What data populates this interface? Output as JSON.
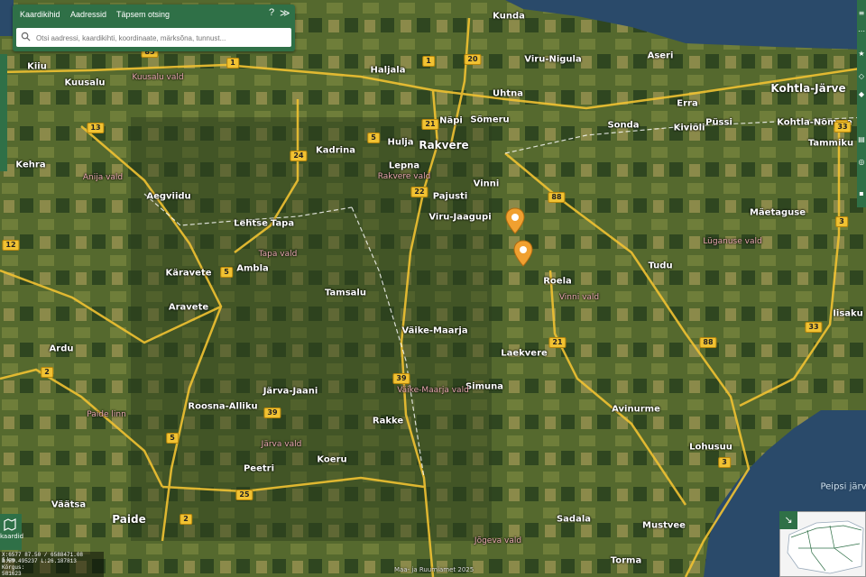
{
  "search_panel": {
    "tabs": [
      "Kaardikihid",
      "Aadressid",
      "Täpsem otsing"
    ],
    "help_label": "?",
    "collapse_label": "≫",
    "search_placeholder": "Otsi aadressi, kaardikihti, koordinaate, märksõna, tunnust..."
  },
  "places": [
    {
      "name": "Kunda",
      "type": "town"
    },
    {
      "name": "Haljala",
      "type": "town"
    },
    {
      "name": "Viru-Nigula",
      "type": "town"
    },
    {
      "name": "Aseri",
      "type": "town"
    },
    {
      "name": "Kohtla-Järve",
      "type": "city"
    },
    {
      "name": "Kohtla-Nõmme",
      "type": "town"
    },
    {
      "name": "Kiiu",
      "type": "town"
    },
    {
      "name": "Kuusalu",
      "type": "town"
    },
    {
      "name": "Uhtna",
      "type": "town"
    },
    {
      "name": "Erra",
      "type": "town"
    },
    {
      "name": "Näpi",
      "type": "town"
    },
    {
      "name": "Sõmeru",
      "type": "town"
    },
    {
      "name": "Sonda",
      "type": "town"
    },
    {
      "name": "Kiviõli",
      "type": "town"
    },
    {
      "name": "Püssi",
      "type": "town"
    },
    {
      "name": "Tammiku",
      "type": "town"
    },
    {
      "name": "Kadrina",
      "type": "town"
    },
    {
      "name": "Hulja",
      "type": "town"
    },
    {
      "name": "Rakvere",
      "type": "city"
    },
    {
      "name": "Lepna",
      "type": "town"
    },
    {
      "name": "Vinni",
      "type": "town"
    },
    {
      "name": "Kehra",
      "type": "town"
    },
    {
      "name": "Aegviidu",
      "type": "town"
    },
    {
      "name": "Pajusti",
      "type": "town"
    },
    {
      "name": "Viru-Jaagupi",
      "type": "town"
    },
    {
      "name": "Lehtse",
      "type": "town"
    },
    {
      "name": "Tapa",
      "type": "town"
    },
    {
      "name": "Mäetaguse",
      "type": "town"
    },
    {
      "name": "Tudu",
      "type": "town"
    },
    {
      "name": "Ambla",
      "type": "town"
    },
    {
      "name": "Käravete",
      "type": "town"
    },
    {
      "name": "Roela",
      "type": "town"
    },
    {
      "name": "Tamsalu",
      "type": "town"
    },
    {
      "name": "Aravete",
      "type": "town"
    },
    {
      "name": "Iisaku",
      "type": "town"
    },
    {
      "name": "Väike-Maarja",
      "type": "town"
    },
    {
      "name": "Ardu",
      "type": "town"
    },
    {
      "name": "Laekvere",
      "type": "town"
    },
    {
      "name": "Järva-Jaani",
      "type": "town"
    },
    {
      "name": "Roosna-Alliku",
      "type": "town"
    },
    {
      "name": "Simuna",
      "type": "town"
    },
    {
      "name": "Avinurme",
      "type": "town"
    },
    {
      "name": "Rakke",
      "type": "town"
    },
    {
      "name": "Lohusuu",
      "type": "town"
    },
    {
      "name": "Koeru",
      "type": "town"
    },
    {
      "name": "Peetri",
      "type": "town"
    },
    {
      "name": "Väätsa",
      "type": "town"
    },
    {
      "name": "Paide",
      "type": "city"
    },
    {
      "name": "Sadala",
      "type": "town"
    },
    {
      "name": "Mustvee",
      "type": "town"
    },
    {
      "name": "Torma",
      "type": "town"
    },
    {
      "name": "Kuusalu vald",
      "type": "parish"
    },
    {
      "name": "Rakvere vald",
      "type": "parish"
    },
    {
      "name": "Anija vald",
      "type": "parish"
    },
    {
      "name": "Tapa vald",
      "type": "parish"
    },
    {
      "name": "Vinni vald",
      "type": "parish"
    },
    {
      "name": "Lüganuse vald",
      "type": "parish"
    },
    {
      "name": "Väike-Maarja vald",
      "type": "parish"
    },
    {
      "name": "Paide linn",
      "type": "parish"
    },
    {
      "name": "Järva vald",
      "type": "parish"
    },
    {
      "name": "Jõgeva vald",
      "type": "parish"
    },
    {
      "name": "Peipsi järv",
      "type": "water"
    }
  ],
  "road_numbers": [
    "1",
    "1",
    "20",
    "85",
    "13",
    "24",
    "5",
    "21",
    "22",
    "88",
    "3",
    "33",
    "21",
    "5",
    "2",
    "39",
    "25",
    "2",
    "5",
    "39",
    "88",
    "3",
    "3",
    "33",
    "12"
  ],
  "bottom": {
    "map_button_label": "kaardid",
    "scale_label": "5 km",
    "coords": [
      "X:6577 87.50 / 6588471.08",
      "B:59.495237 L:26.187813",
      "Kõrgus:",
      "581623"
    ],
    "copyright": "Maa- ja Ruumiamet 2025"
  },
  "markers_count": 2,
  "colors": {
    "panel": "#2f7047",
    "road": "#f1c232",
    "water": "#2a4a6a"
  }
}
